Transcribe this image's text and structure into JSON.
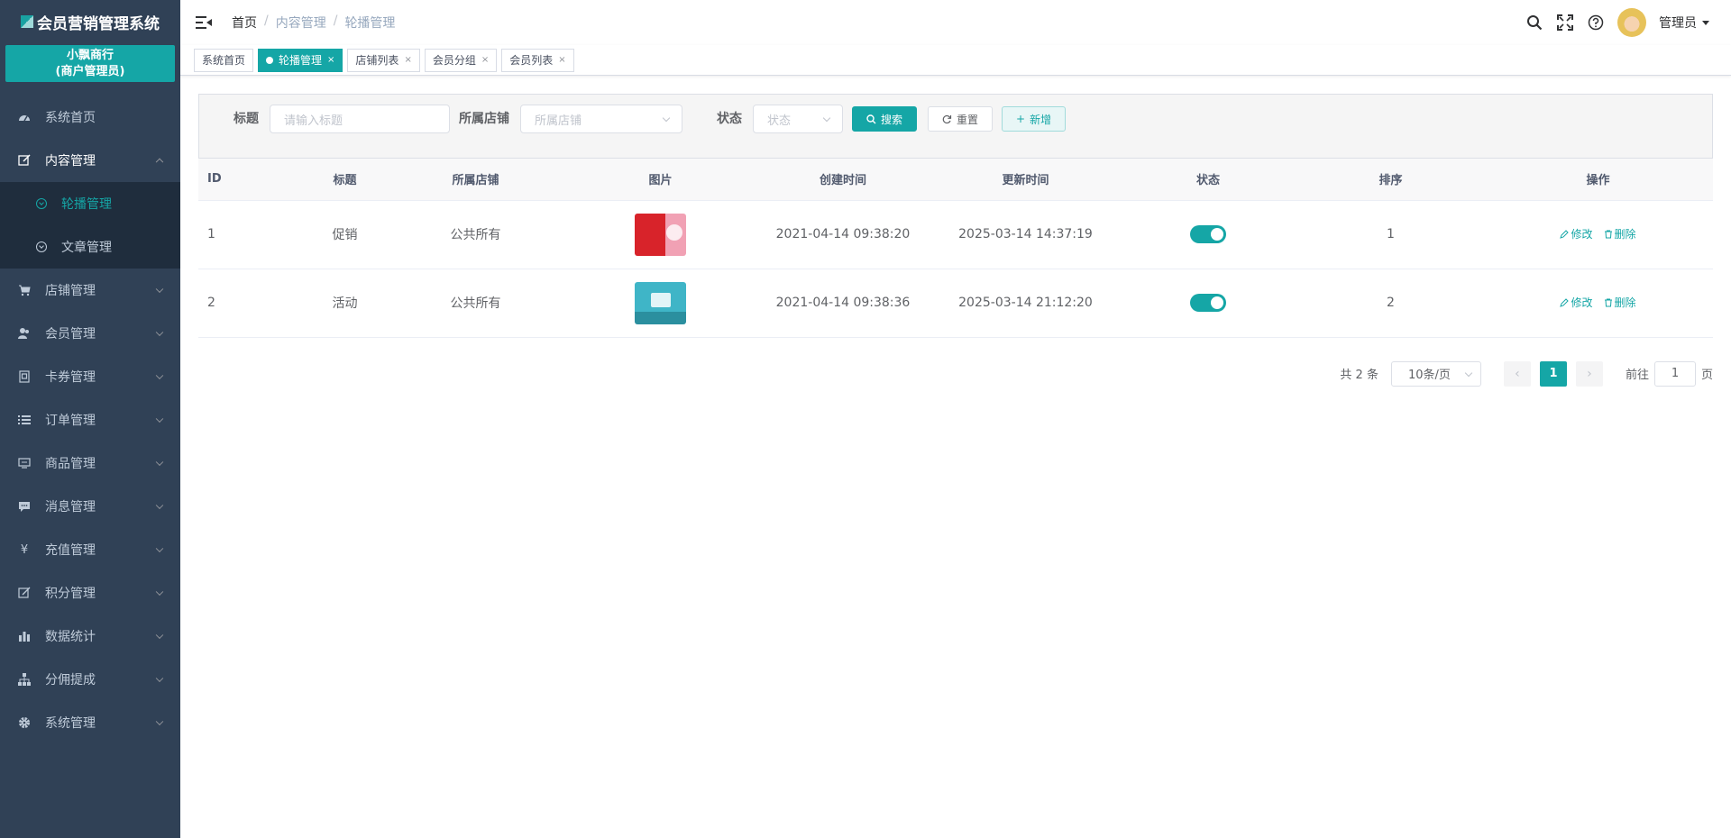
{
  "app": {
    "title": "会员营销管理系统",
    "merchant_name": "小飘商行",
    "merchant_role": "(商户管理员)"
  },
  "sidebar": {
    "items": [
      {
        "label": "系统首页",
        "icon": "dashboard-icon"
      },
      {
        "label": "内容管理",
        "icon": "edit-icon",
        "open": true,
        "children": [
          {
            "label": "轮播管理",
            "active": true
          },
          {
            "label": "文章管理"
          }
        ]
      },
      {
        "label": "店铺管理",
        "icon": "cart-icon"
      },
      {
        "label": "会员管理",
        "icon": "users-icon"
      },
      {
        "label": "卡券管理",
        "icon": "card-icon"
      },
      {
        "label": "订单管理",
        "icon": "list-icon"
      },
      {
        "label": "商品管理",
        "icon": "monitor-icon"
      },
      {
        "label": "消息管理",
        "icon": "message-icon"
      },
      {
        "label": "充值管理",
        "icon": "yen-icon"
      },
      {
        "label": "积分管理",
        "icon": "points-icon"
      },
      {
        "label": "数据统计",
        "icon": "chart-icon"
      },
      {
        "label": "分佣提成",
        "icon": "org-icon"
      },
      {
        "label": "系统管理",
        "icon": "gear-icon"
      }
    ]
  },
  "header": {
    "breadcrumb": [
      "首页",
      "内容管理",
      "轮播管理"
    ],
    "user": "管理员"
  },
  "tags": [
    {
      "label": "系统首页",
      "active": false,
      "closable": false
    },
    {
      "label": "轮播管理",
      "active": true,
      "closable": true
    },
    {
      "label": "店铺列表",
      "active": false,
      "closable": true
    },
    {
      "label": "会员分组",
      "active": false,
      "closable": true
    },
    {
      "label": "会员列表",
      "active": false,
      "closable": true
    }
  ],
  "search": {
    "title_label": "标题",
    "title_placeholder": "请输入标题",
    "shop_label": "所属店铺",
    "shop_placeholder": "所属店铺",
    "status_label": "状态",
    "status_placeholder": "状态",
    "search_btn": "搜索",
    "reset_btn": "重置",
    "add_btn": "新增"
  },
  "table": {
    "columns": [
      "ID",
      "标题",
      "所属店铺",
      "图片",
      "创建时间",
      "更新时间",
      "状态",
      "排序",
      "操作"
    ],
    "rows": [
      {
        "id": "1",
        "title": "促销",
        "shop": "公共所有",
        "created": "2021-04-14 09:38:20",
        "updated": "2025-03-14 14:37:19",
        "status": true,
        "sort": "1"
      },
      {
        "id": "2",
        "title": "活动",
        "shop": "公共所有",
        "created": "2021-04-14 09:38:36",
        "updated": "2025-03-14 21:12:20",
        "status": true,
        "sort": "2"
      }
    ],
    "edit_label": "修改",
    "delete_label": "删除"
  },
  "pagination": {
    "total_text": "共 2 条",
    "page_size": "10条/页",
    "current_page": "1",
    "goto_label": "前往",
    "goto_value": "1",
    "page_suffix": "页"
  },
  "colors": {
    "accent": "#15a6a6",
    "sidebar_bg": "#304156",
    "submenu_bg": "#1f2d3d"
  }
}
